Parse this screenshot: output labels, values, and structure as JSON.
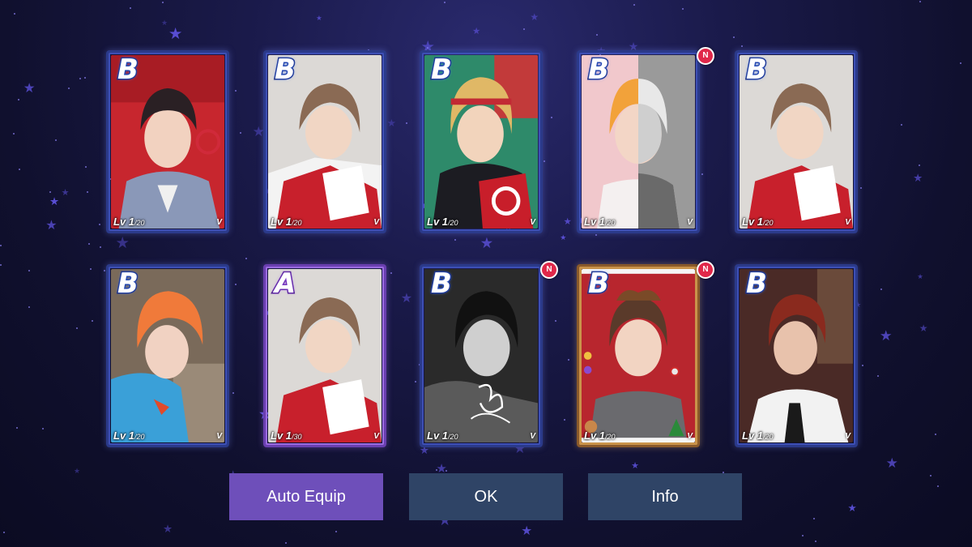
{
  "cards": [
    {
      "grade": "B",
      "level": "Lv 1",
      "max": "/20",
      "member": "V",
      "is_new": false,
      "theme": "red-suit"
    },
    {
      "grade": "B",
      "level": "Lv 1",
      "max": "/20",
      "member": "V",
      "is_new": false,
      "theme": "red-white-jacket"
    },
    {
      "grade": "B",
      "level": "Lv 1",
      "max": "/20",
      "member": "V",
      "is_new": false,
      "theme": "blonde-red-hoodie"
    },
    {
      "grade": "B",
      "level": "Lv 1",
      "max": "/20",
      "member": "V",
      "is_new": true,
      "theme": "split-orange-grey"
    },
    {
      "grade": "B",
      "level": "Lv 1",
      "max": "/20",
      "member": "V",
      "is_new": false,
      "theme": "red-white-jacket"
    },
    {
      "grade": "B",
      "level": "Lv 1",
      "max": "/20",
      "member": "V",
      "is_new": false,
      "theme": "orange-hair-blue"
    },
    {
      "grade": "A",
      "level": "Lv 1",
      "max": "/30",
      "member": "V",
      "is_new": false,
      "theme": "red-white-jacket"
    },
    {
      "grade": "B",
      "level": "Lv 1",
      "max": "/20",
      "member": "V",
      "is_new": true,
      "theme": "black-white-signed"
    },
    {
      "grade": "B",
      "level": "Lv 1",
      "max": "/20",
      "member": "V",
      "is_new": true,
      "theme": "christmas"
    },
    {
      "grade": "B",
      "level": "Lv 1",
      "max": "/20",
      "member": "V",
      "is_new": false,
      "theme": "dark-red-hair-shirt"
    }
  ],
  "new_badge_label": "N",
  "buttons": {
    "auto_equip": "Auto Equip",
    "ok": "OK",
    "info": "Info"
  },
  "colors": {
    "background": "#10102e",
    "auto_equip": "#6e4fba",
    "secondary_button": "#2f4466",
    "card_border_b": "#2b3a8a",
    "card_border_a": "#6a3fb0",
    "new_badge": "#e0284a"
  }
}
